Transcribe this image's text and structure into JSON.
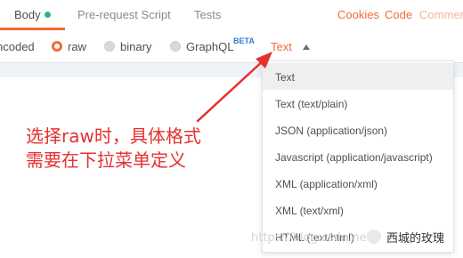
{
  "tabs": {
    "items": [
      {
        "label": "Body"
      },
      {
        "label": "Pre-request Script"
      },
      {
        "label": "Tests"
      }
    ],
    "right": {
      "cookies": "Cookies",
      "code": "Code",
      "comments": "Commen"
    }
  },
  "body_mode": {
    "encoded_label": "ncoded",
    "options": [
      {
        "label": "raw",
        "selected": true
      },
      {
        "label": "binary",
        "selected": false
      },
      {
        "label": "GraphQL",
        "selected": false
      }
    ],
    "beta_badge": "BETA",
    "type_select": "Text"
  },
  "dropdown": {
    "items": [
      "Text",
      "Text (text/plain)",
      "JSON (application/json)",
      "Javascript (application/javascript)",
      "XML (application/xml)",
      "XML (text/xml)",
      "HTML (text/html)"
    ],
    "highlighted_index": 0
  },
  "annotation": {
    "lines": [
      "选择raw时，具体格式",
      "需要在下拉菜单定义"
    ],
    "color": "#e53030"
  },
  "watermark": {
    "url": "https://blog.csdn.net",
    "account": "西城的玫瑰"
  },
  "colors": {
    "accent": "#f26b3a",
    "status_green": "#2fb672",
    "beta_blue": "#2e7ed6"
  }
}
